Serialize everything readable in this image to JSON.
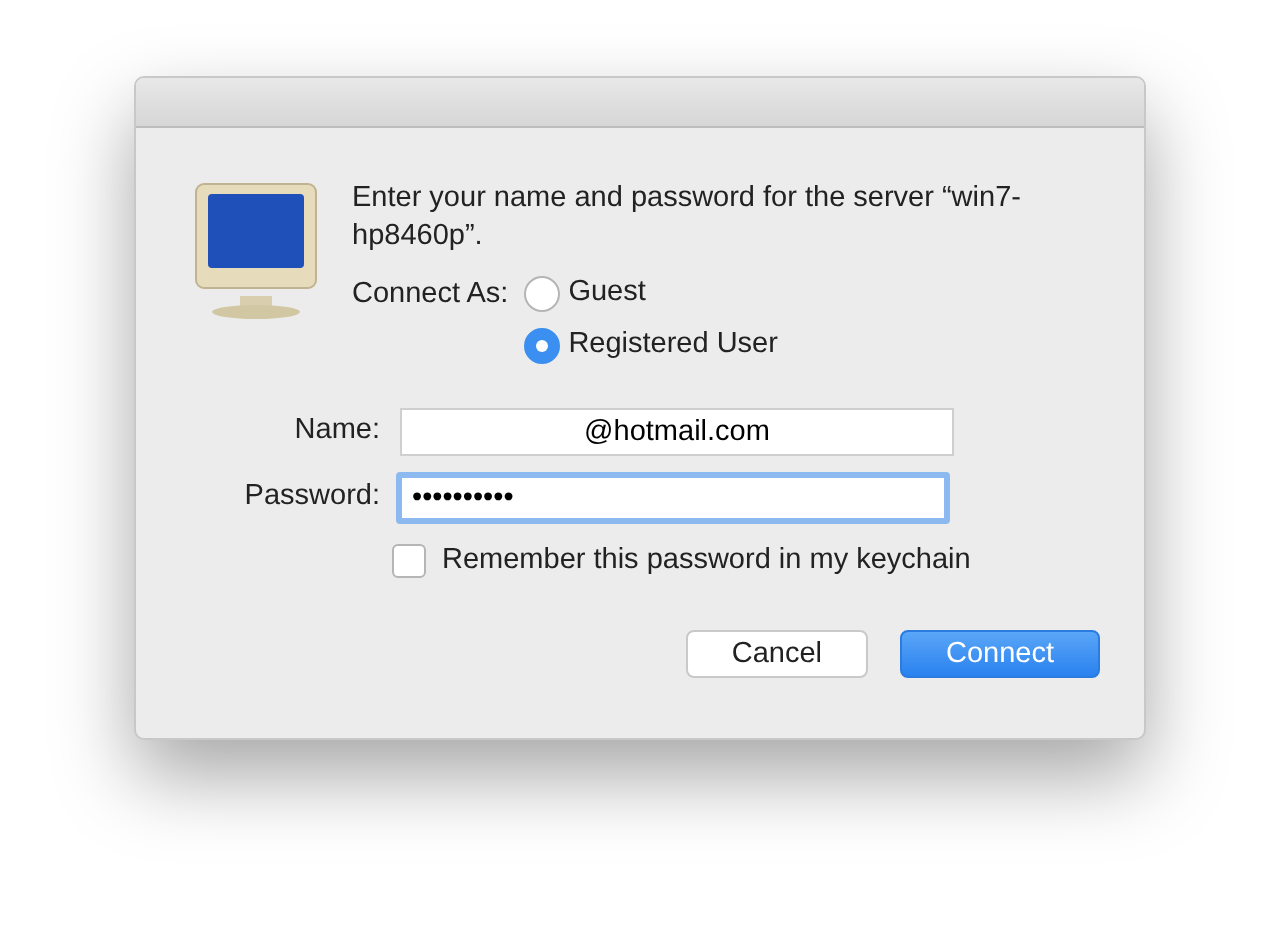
{
  "message": "Enter your name and password for the server “win7-hp8460p”.",
  "connect_as": {
    "label": "Connect As:",
    "options": [
      {
        "label": "Guest",
        "selected": false
      },
      {
        "label": "Registered User",
        "selected": true
      }
    ]
  },
  "fields": [
    {
      "label": "Name:",
      "value": "@hotmail.com",
      "focused": false,
      "centered": true
    },
    {
      "label": "Password:",
      "value": "••••••••••",
      "focused": true,
      "centered": false
    }
  ],
  "remember": {
    "label": "Remember this password in my keychain",
    "checked": false
  },
  "buttons": [
    {
      "label": "Cancel",
      "kind": "secondary"
    },
    {
      "label": "Connect",
      "kind": "primary"
    }
  ]
}
